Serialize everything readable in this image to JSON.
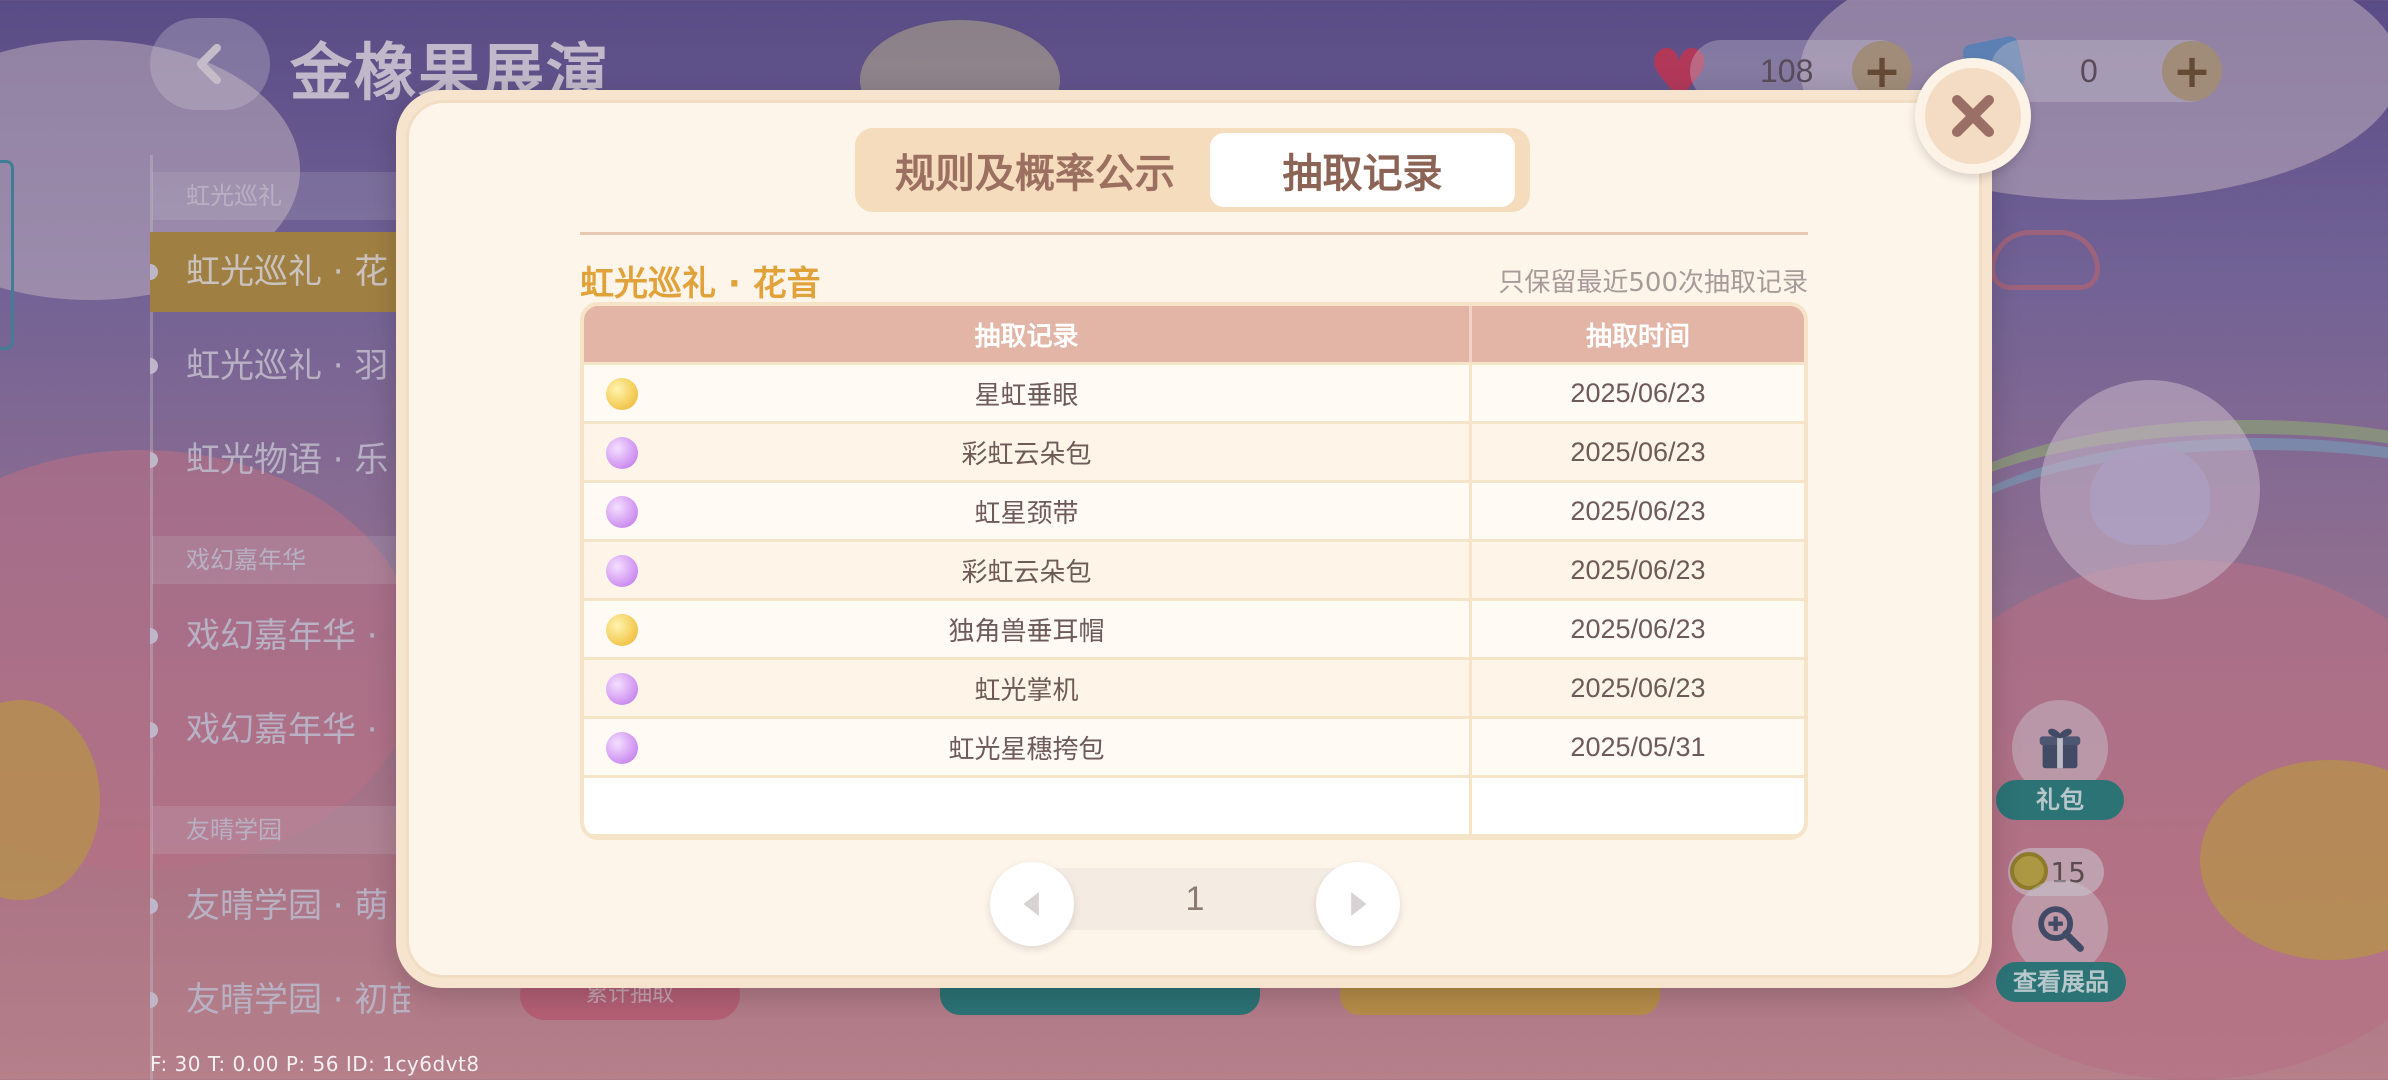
{
  "header": {
    "title": "金橡果展演",
    "resources": [
      {
        "name": "heart",
        "icon": "heart-icon",
        "value": "108"
      },
      {
        "name": "ticket",
        "icon": "ticket-icon",
        "value": "0"
      }
    ],
    "plus_label": "+"
  },
  "sidebar": {
    "sections": [
      {
        "label": "虹光巡礼"
      },
      {
        "label": "戏幻嘉年华"
      },
      {
        "label": "友晴学园"
      }
    ],
    "items": [
      {
        "label": "虹光巡礼 · 花",
        "active": true
      },
      {
        "label": "虹光巡礼 · 羽"
      },
      {
        "label": "虹光物语 · 乐"
      },
      {
        "label": "戏幻嘉年华 ·"
      },
      {
        "label": "戏幻嘉年华 ·"
      },
      {
        "label": "友晴学园 · 萌"
      },
      {
        "label": "友晴学园 · 初苗"
      }
    ]
  },
  "right_panel": {
    "gift_label": "礼包",
    "coin_count": "15",
    "view_label": "查看展品"
  },
  "bottom": {
    "badge_label": "累计抽取"
  },
  "debug": "F: 30    T: 0.00    P: 56    ID: 1cy6dvt8",
  "modal": {
    "tabs": [
      {
        "label": "规则及概率公示",
        "active": false
      },
      {
        "label": "抽取记录",
        "active": true
      }
    ],
    "section_title": "虹光巡礼 · 花音",
    "keep_note": "只保留最近500次抽取记录",
    "columns": [
      "抽取记录",
      "抽取时间"
    ],
    "rows": [
      {
        "rarity": "gold",
        "item": "星虹垂眼",
        "time": "2025/06/23"
      },
      {
        "rarity": "purple",
        "item": "彩虹云朵包",
        "time": "2025/06/23"
      },
      {
        "rarity": "purple",
        "item": "虹星颈带",
        "time": "2025/06/23"
      },
      {
        "rarity": "purple",
        "item": "彩虹云朵包",
        "time": "2025/06/23"
      },
      {
        "rarity": "gold",
        "item": "独角兽垂耳帽",
        "time": "2025/06/23"
      },
      {
        "rarity": "purple",
        "item": "虹光掌机",
        "time": "2025/06/23"
      },
      {
        "rarity": "purple",
        "item": "虹光星穗挎包",
        "time": "2025/05/31"
      }
    ],
    "pager": {
      "page": "1"
    }
  },
  "colors": {
    "accent_gold": "#e2a23a",
    "header_row": "#e2b5a6",
    "rarity_gold": "#f5d060",
    "rarity_purple": "#d6a0f4"
  }
}
